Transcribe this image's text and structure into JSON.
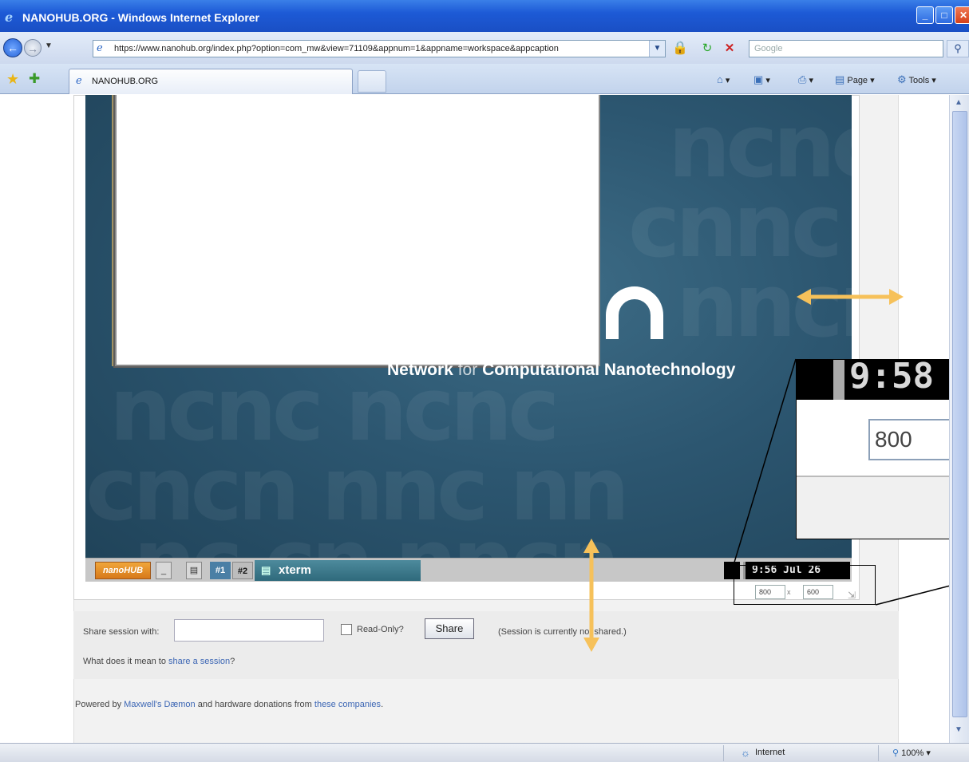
{
  "window": {
    "title": "NANOHUB.ORG - Windows Internet Explorer",
    "ie_icon": "ie-logo-icon",
    "min_glyph": "_",
    "max_glyph": "□",
    "close_glyph": "✕"
  },
  "address_bar": {
    "url": "https://www.nanohub.org/index.php?option=com_mw&view=71109&appnum=1&appname=workspace&appcaption",
    "search_placeholder": "Google"
  },
  "tab_bar": {
    "active_tab": "NANOHUB.ORG",
    "commands": [
      "Page",
      "Tools"
    ]
  },
  "desktop": {
    "slogan_bold_left": "Network",
    "slogan_thin": "for",
    "slogan_bold_right": "Computational Nanotechnology"
  },
  "taskbar": {
    "start_label": "nanoHUB",
    "workspace_1": "#1",
    "workspace_2": "#2",
    "xterm_label": "xterm",
    "clock": "9:56 Jul 26"
  },
  "size_controls": {
    "width_value": "800",
    "separator": "x",
    "height_value": "600"
  },
  "zoom_overlay": {
    "clock_text": "9:58",
    "width_value": "800"
  },
  "share": {
    "label": "Share session with:",
    "readonly_label": "Read-Only?",
    "button_label": "Share",
    "status": "(Session is currently not shared.)",
    "help_prefix": "What does it mean to",
    "help_link": "share a session",
    "help_suffix": "?"
  },
  "footer": {
    "powered_prefix": "Powered by",
    "daemon_link": "Maxwell's Dæmon",
    "middle": "and hardware donations from",
    "companies_link": "these companies",
    "suffix": "."
  },
  "status_bar": {
    "zone": "Internet",
    "zoom": "100%"
  },
  "colors": {
    "accent_arrow": "#f6c15a",
    "desktop_bg": "#2c5670",
    "title_blue": "#1d5ad6"
  }
}
